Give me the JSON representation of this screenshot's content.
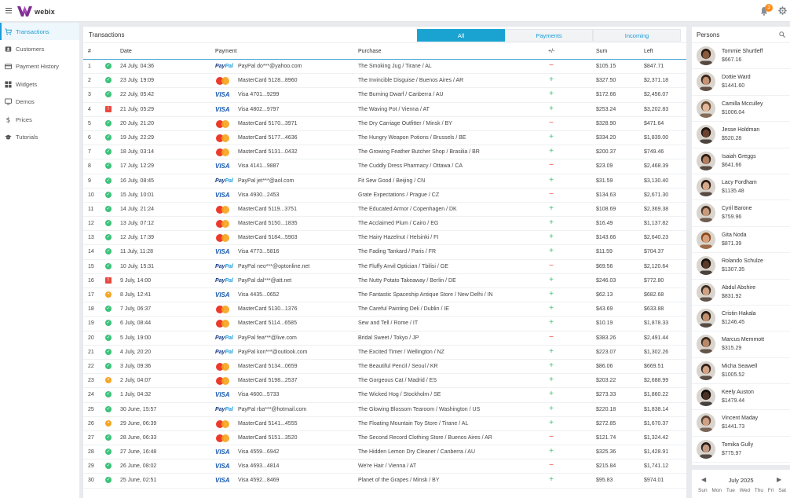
{
  "app": {
    "name": "webix",
    "notifications": "3"
  },
  "sidebar": {
    "items": [
      {
        "label": "Transactions",
        "icon": "cart-icon",
        "active": true
      },
      {
        "label": "Customers",
        "icon": "user-card-icon",
        "active": false
      },
      {
        "label": "Payment History",
        "icon": "card-icon",
        "active": false
      },
      {
        "label": "Widgets",
        "icon": "grid-icon",
        "active": false
      },
      {
        "label": "Demos",
        "icon": "monitor-icon",
        "active": false
      },
      {
        "label": "Prices",
        "icon": "dollar-icon",
        "active": false
      },
      {
        "label": "Tutorials",
        "icon": "graduation-cap-icon",
        "active": false
      }
    ]
  },
  "main": {
    "title": "Transactions",
    "tabs": [
      {
        "label": "All",
        "active": true
      },
      {
        "label": "Payments",
        "active": false
      },
      {
        "label": "Incoming",
        "active": false
      }
    ],
    "columns": {
      "num": "#",
      "date": "Date",
      "payment": "Payment",
      "purchase": "Purchase",
      "pm": "+/-",
      "sum": "Sum",
      "left": "Left"
    },
    "rows": [
      {
        "n": "1",
        "status": "ok",
        "date": "24 July, 04:36",
        "type": "paypal",
        "pay": "PayPal do***@yahoo.com",
        "purchase": "The Smoking Jug / Tirane / AL",
        "sign": "minus",
        "sum": "$105.15",
        "left": "$847.71"
      },
      {
        "n": "2",
        "status": "ok",
        "date": "23 July, 19:09",
        "type": "mc",
        "pay": "MasterCard 5128...8960",
        "purchase": "The Invincible Disguise / Buenos Aires / AR",
        "sign": "plus",
        "sum": "$327.50",
        "left": "$2,371.18"
      },
      {
        "n": "3",
        "status": "ok",
        "date": "22 July, 05:42",
        "type": "visa",
        "pay": "Visa 4701...9299",
        "purchase": "The Burning Dwarf / Canberra / AU",
        "sign": "plus",
        "sum": "$172.66",
        "left": "$2,456.07"
      },
      {
        "n": "4",
        "status": "err",
        "date": "21 July, 05:29",
        "type": "visa",
        "pay": "Visa 4802...9797",
        "purchase": "The Waving Pot / Vienna / AT",
        "sign": "plus",
        "sum": "$253.24",
        "left": "$3,202.83"
      },
      {
        "n": "5",
        "status": "ok",
        "date": "20 July, 21:20",
        "type": "mc",
        "pay": "MasterCard 5170...3971",
        "purchase": "The Dry Carriage Outfitter / Minsk / BY",
        "sign": "minus",
        "sum": "$328.90",
        "left": "$471.64"
      },
      {
        "n": "6",
        "status": "ok",
        "date": "19 July, 22:29",
        "type": "mc",
        "pay": "MasterCard 5177...4636",
        "purchase": "The Hungry Weapon Potions / Brussels / BE",
        "sign": "plus",
        "sum": "$334.20",
        "left": "$1,839.00"
      },
      {
        "n": "7",
        "status": "ok",
        "date": "18 July, 03:14",
        "type": "mc",
        "pay": "MasterCard 5131...0432",
        "purchase": "The Growing Feather Butcher Shop / Brasilia / BR",
        "sign": "plus",
        "sum": "$200.37",
        "left": "$749.46"
      },
      {
        "n": "8",
        "status": "ok",
        "date": "17 July, 12:29",
        "type": "visa",
        "pay": "Visa 4141...9887",
        "purchase": "The Cuddly Dress Pharmacy / Ottawa / CA",
        "sign": "minus",
        "sum": "$23.09",
        "left": "$2,468.39"
      },
      {
        "n": "9",
        "status": "ok",
        "date": "16 July, 08:45",
        "type": "paypal",
        "pay": "PayPal jet***@aol.com",
        "purchase": "Fit Sew Good / Beijing / CN",
        "sign": "plus",
        "sum": "$31.59",
        "left": "$3,130.40"
      },
      {
        "n": "10",
        "status": "ok",
        "date": "15 July, 10:01",
        "type": "visa",
        "pay": "Visa 4930...2453",
        "purchase": "Grate Expectations / Prague / CZ",
        "sign": "minus",
        "sum": "$134.63",
        "left": "$2,671.30"
      },
      {
        "n": "11",
        "status": "ok",
        "date": "14 July, 21:24",
        "type": "mc",
        "pay": "MasterCard 5119...3751",
        "purchase": "The Educated Armor / Copenhagen / DK",
        "sign": "plus",
        "sum": "$108.69",
        "left": "$2,369.38"
      },
      {
        "n": "12",
        "status": "ok",
        "date": "13 July, 07:12",
        "type": "mc",
        "pay": "MasterCard 5150...1835",
        "purchase": "The Acclaimed Plum / Cairo / EG",
        "sign": "plus",
        "sum": "$16.49",
        "left": "$1,137.82"
      },
      {
        "n": "13",
        "status": "ok",
        "date": "12 July, 17:39",
        "type": "mc",
        "pay": "MasterCard 5184...5903",
        "purchase": "The Hairy Hazelnut / Helsinki / FI",
        "sign": "plus",
        "sum": "$143.66",
        "left": "$2,640.23"
      },
      {
        "n": "14",
        "status": "ok",
        "date": "11 July, 11:28",
        "type": "visa",
        "pay": "Visa 4773...5816",
        "purchase": "The Fading Tankard / Paris / FR",
        "sign": "plus",
        "sum": "$11.59",
        "left": "$704.37"
      },
      {
        "n": "15",
        "status": "ok",
        "date": "10 July, 15:31",
        "type": "paypal",
        "pay": "PayPal neo***@optonline.net",
        "purchase": "The Fluffy Anvil Optician / Tbilisi / GE",
        "sign": "minus",
        "sum": "$69.56",
        "left": "$2,120.64"
      },
      {
        "n": "16",
        "status": "err",
        "date": "9 July, 14:00",
        "type": "paypal",
        "pay": "PayPal dal***@att.net",
        "purchase": "The Nutty Potato Takeaway / Berlin / DE",
        "sign": "plus",
        "sum": "$246.03",
        "left": "$772.80"
      },
      {
        "n": "17",
        "status": "warn",
        "date": "8 July, 12:41",
        "type": "visa",
        "pay": "Visa 4435...0652",
        "purchase": "The Fantastic Spaceship Antique Store / New Delhi / IN",
        "sign": "plus",
        "sum": "$62.13",
        "left": "$682.68"
      },
      {
        "n": "18",
        "status": "ok",
        "date": "7 July, 06:37",
        "type": "mc",
        "pay": "MasterCard 5130...1376",
        "purchase": "The Careful Painting Deli / Dublin / IE",
        "sign": "plus",
        "sum": "$43.69",
        "left": "$633.88"
      },
      {
        "n": "19",
        "status": "ok",
        "date": "6 July, 08:44",
        "type": "mc",
        "pay": "MasterCard 5114...6585",
        "purchase": "Sew and Tell / Rome / IT",
        "sign": "plus",
        "sum": "$10.19",
        "left": "$1,878.33"
      },
      {
        "n": "20",
        "status": "ok",
        "date": "5 July, 19:00",
        "type": "paypal",
        "pay": "PayPal fea***@live.com",
        "purchase": "Bridal Sweet / Tokyo / JP",
        "sign": "minus",
        "sum": "$383.26",
        "left": "$2,491.44"
      },
      {
        "n": "21",
        "status": "ok",
        "date": "4 July, 20:20",
        "type": "paypal",
        "pay": "PayPal kon***@outlook.com",
        "purchase": "The Excited Timer / Wellington / NZ",
        "sign": "plus",
        "sum": "$223.07",
        "left": "$1,302.26"
      },
      {
        "n": "22",
        "status": "ok",
        "date": "3 July, 09:36",
        "type": "mc",
        "pay": "MasterCard 5134...0659",
        "purchase": "The Beautiful Pencil / Seoul / KR",
        "sign": "plus",
        "sum": "$86.06",
        "left": "$669.51"
      },
      {
        "n": "23",
        "status": "warn",
        "date": "2 July, 04:07",
        "type": "mc",
        "pay": "MasterCard 5198...2537",
        "purchase": "The Gorgeous Cat / Madrid / ES",
        "sign": "plus",
        "sum": "$203.22",
        "left": "$2,688.99"
      },
      {
        "n": "24",
        "status": "ok",
        "date": "1 July, 04:32",
        "type": "visa",
        "pay": "Visa 4600...5733",
        "purchase": "The Wicked Hog / Stockholm / SE",
        "sign": "plus",
        "sum": "$273.33",
        "left": "$1,860.22"
      },
      {
        "n": "25",
        "status": "ok",
        "date": "30 June, 15:57",
        "type": "paypal",
        "pay": "PayPal rba***@hotmail.com",
        "purchase": "The Glowing Blossom Tearoom / Washington / US",
        "sign": "plus",
        "sum": "$220.18",
        "left": "$1,838.14"
      },
      {
        "n": "26",
        "status": "warn",
        "date": "29 June, 06:39",
        "type": "mc",
        "pay": "MasterCard 5141...4555",
        "purchase": "The Floating Mountain Toy Store / Tirane / AL",
        "sign": "plus",
        "sum": "$272.85",
        "left": "$1,670.37"
      },
      {
        "n": "27",
        "status": "ok",
        "date": "28 June, 06:33",
        "type": "mc",
        "pay": "MasterCard 5151...3520",
        "purchase": "The Second Record Clothing Store / Buenos Aires / AR",
        "sign": "minus",
        "sum": "$121.74",
        "left": "$1,324.42"
      },
      {
        "n": "28",
        "status": "ok",
        "date": "27 June, 16:48",
        "type": "visa",
        "pay": "Visa 4559...6942",
        "purchase": "The Hidden Lemon Dry Cleaner / Canberra / AU",
        "sign": "plus",
        "sum": "$325.36",
        "left": "$1,428.91"
      },
      {
        "n": "29",
        "status": "ok",
        "date": "26 June, 08:02",
        "type": "visa",
        "pay": "Visa 4693...4814",
        "purchase": "We're Hair / Vienna / AT",
        "sign": "minus",
        "sum": "$215.84",
        "left": "$1,741.12"
      },
      {
        "n": "30",
        "status": "ok",
        "date": "25 June, 02:51",
        "type": "visa",
        "pay": "Visa 4592...8469",
        "purchase": "Planet of the Grapes / Minsk / BY",
        "sign": "plus",
        "sum": "$95.83",
        "left": "$974.01"
      }
    ]
  },
  "persons": {
    "title": "Persons",
    "list": [
      {
        "name": "Tommie Shurtleff",
        "amount": "$667.16",
        "skin": "#8a5a3c",
        "hair": "#2a1a10"
      },
      {
        "name": "Dottie Ward",
        "amount": "$1441.60",
        "skin": "#c49274",
        "hair": "#3a2418"
      },
      {
        "name": "Camilla Mcculley",
        "amount": "$1006.04",
        "skin": "#e2b79a",
        "hair": "#6a4a30"
      },
      {
        "name": "Jesse Holdman",
        "amount": "$520.28",
        "skin": "#6b4330",
        "hair": "#1e1410"
      },
      {
        "name": "Isaiah Greggs",
        "amount": "$641.66",
        "skin": "#b07e60",
        "hair": "#2a1c12"
      },
      {
        "name": "Lacy Fordham",
        "amount": "$1135.48",
        "skin": "#d7a98a",
        "hair": "#2c1c14"
      },
      {
        "name": "Cyril Barone",
        "amount": "$759.96",
        "skin": "#c89a7c",
        "hair": "#4a3424"
      },
      {
        "name": "Gita Noda",
        "amount": "$871.39",
        "skin": "#d6a07a",
        "hair": "#8a4a1e"
      },
      {
        "name": "Rolando Schulze",
        "amount": "$1307.35",
        "skin": "#5a3a28",
        "hair": "#1a120c"
      },
      {
        "name": "Abdul Abshire",
        "amount": "$831.92",
        "skin": "#cfa184",
        "hair": "#3a2a20"
      },
      {
        "name": "Cristin Hakala",
        "amount": "$1246.45",
        "skin": "#c08f6e",
        "hair": "#2a1e14"
      },
      {
        "name": "Marcus Memmott",
        "amount": "$315.29",
        "skin": "#b98868",
        "hair": "#3a2a1c"
      },
      {
        "name": "Micha Seawell",
        "amount": "$1005.52",
        "skin": "#d3a386",
        "hair": "#2e2018"
      },
      {
        "name": "Keely Auston",
        "amount": "$1479.44",
        "skin": "#4a3226",
        "hair": "#141010"
      },
      {
        "name": "Vincent Maday",
        "amount": "$1441.73",
        "skin": "#cfa086",
        "hair": "#5a4232"
      },
      {
        "name": "Tomika Gully",
        "amount": "$775.97",
        "skin": "#c49a82",
        "hair": "#2a1e18"
      }
    ]
  },
  "calendar": {
    "month": "July 2025",
    "days": [
      "Sun",
      "Mon",
      "Tue",
      "Wed",
      "Thu",
      "Fri",
      "Sat"
    ]
  }
}
